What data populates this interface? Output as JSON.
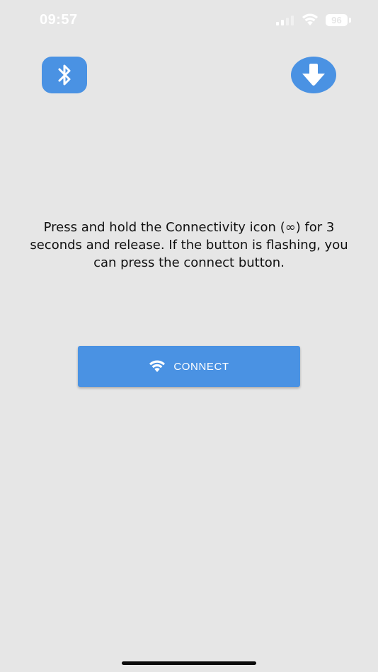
{
  "status_bar": {
    "time": "09:57",
    "battery": "96",
    "icons": [
      "signal-icon",
      "wifi-icon",
      "battery-icon"
    ]
  },
  "toolbar": {
    "left_icon": "bluetooth-icon",
    "right_icon": "download-icon",
    "accent": "#4a92e3"
  },
  "main": {
    "instructions": "Press and hold the Connectivity icon (∞) for 3 seconds and release. If the button is flashing, you can press the connect button.",
    "connect_label": "CONNECT",
    "connect_icon": "wifi-icon"
  }
}
